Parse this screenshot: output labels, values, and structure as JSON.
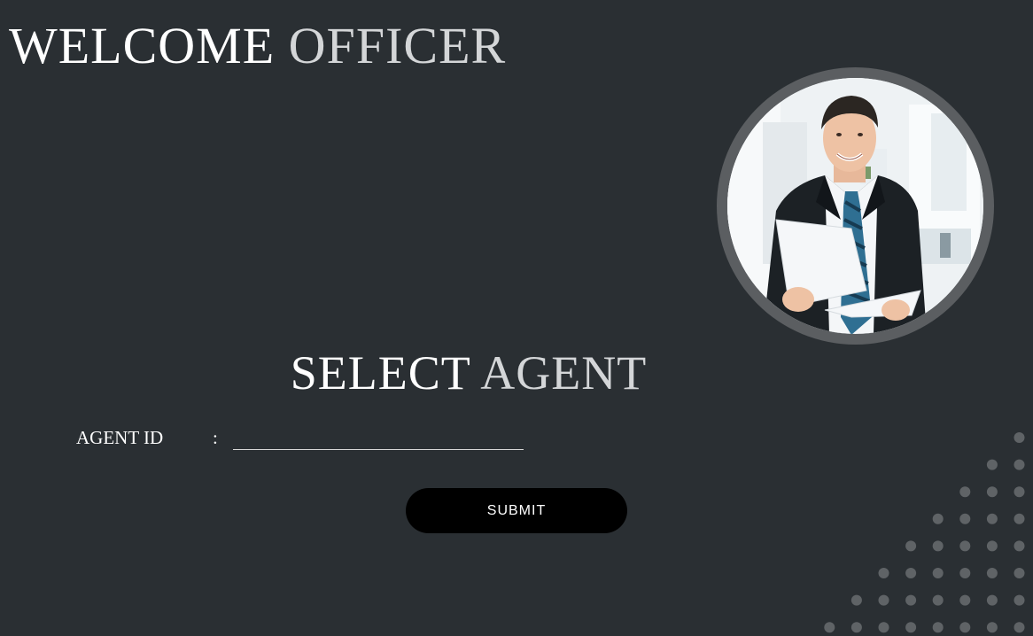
{
  "header": {
    "title_part1": "WELCOME",
    "title_part2": "OFFICER"
  },
  "portrait": {
    "icon": "officer-portrait"
  },
  "form": {
    "title_part1": "SELECT",
    "title_part2": "AGENT",
    "agent_id_label": "AGENT ID",
    "separator": ":",
    "agent_id_value": "",
    "submit_label": "SUBMIT"
  },
  "colors": {
    "background": "#2a2f33",
    "accent_white": "#ffffff",
    "accent_grey": "#d4d6d8",
    "button": "#000000",
    "dots": "#5f6366"
  }
}
